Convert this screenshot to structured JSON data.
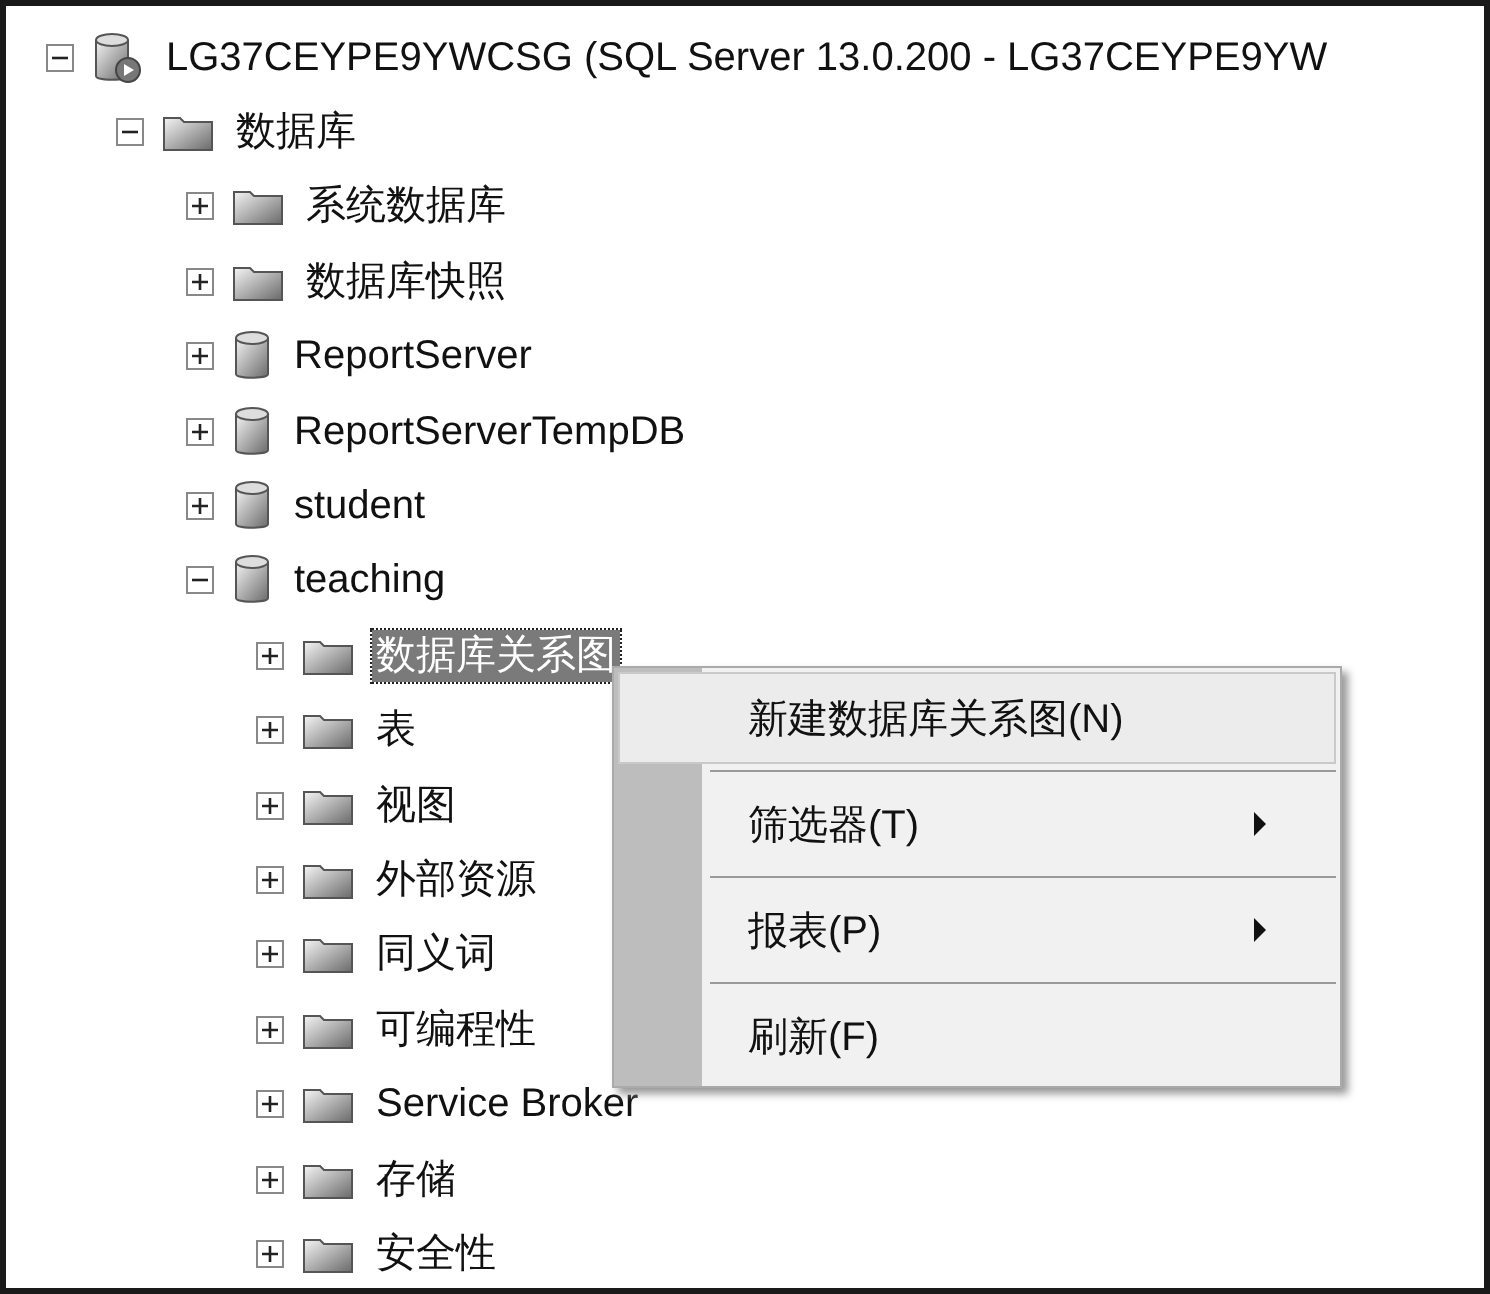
{
  "tree": [
    {
      "kind": "server",
      "label": "LG37CEYPE9YWCSG (SQL Server 13.0.200 - LG37CEYPE9YW",
      "expanded": true,
      "selected": false,
      "children": [
        {
          "kind": "folder",
          "label": "数据库",
          "expanded": true,
          "selected": false,
          "children": [
            {
              "kind": "folder",
              "label": "系统数据库",
              "expanded": false,
              "selected": false
            },
            {
              "kind": "folder",
              "label": "数据库快照",
              "expanded": false,
              "selected": false
            },
            {
              "kind": "database",
              "label": "ReportServer",
              "expanded": false,
              "selected": false
            },
            {
              "kind": "database",
              "label": "ReportServerTempDB",
              "expanded": false,
              "selected": false
            },
            {
              "kind": "database",
              "label": "student",
              "expanded": false,
              "selected": false
            },
            {
              "kind": "database",
              "label": "teaching",
              "expanded": true,
              "selected": false,
              "children": [
                {
                  "kind": "folder",
                  "label": "数据库关系图",
                  "expanded": false,
                  "selected": true
                },
                {
                  "kind": "folder",
                  "label": "表",
                  "expanded": false,
                  "selected": false
                },
                {
                  "kind": "folder",
                  "label": "视图",
                  "expanded": false,
                  "selected": false
                },
                {
                  "kind": "folder",
                  "label": "外部资源",
                  "expanded": false,
                  "selected": false
                },
                {
                  "kind": "folder",
                  "label": "同义词",
                  "expanded": false,
                  "selected": false
                },
                {
                  "kind": "folder",
                  "label": "可编程性",
                  "expanded": false,
                  "selected": false
                },
                {
                  "kind": "folder",
                  "label": "Service Broker",
                  "expanded": false,
                  "selected": false
                },
                {
                  "kind": "folder",
                  "label": "存储",
                  "expanded": false,
                  "selected": false
                },
                {
                  "kind": "folder",
                  "label": "安全性",
                  "expanded": false,
                  "selected": false
                }
              ]
            }
          ]
        }
      ]
    }
  ],
  "context_menu": {
    "items": [
      {
        "label": "新建数据库关系图(N)",
        "highlighted": true,
        "submenu": false
      },
      {
        "label": "筛选器(T)",
        "highlighted": false,
        "submenu": true
      },
      {
        "label": "报表(P)",
        "highlighted": false,
        "submenu": true
      },
      {
        "label": "刷新(F)",
        "highlighted": false,
        "submenu": false
      }
    ]
  }
}
